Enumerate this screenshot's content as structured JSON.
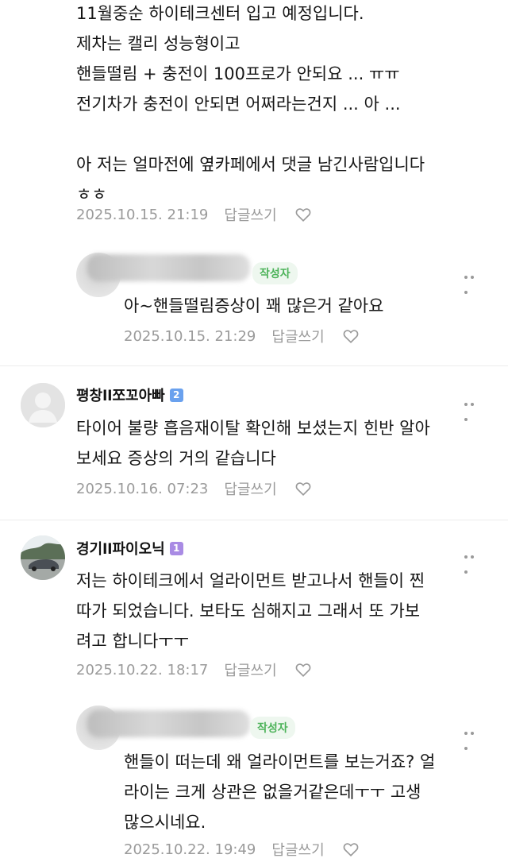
{
  "comments": [
    {
      "text": "11월중순 하이테크센터 입고 예정입니다.\n제차는 캘리 성능형이고\n핸들떨림 + 충전이 100프로가 안되요 ... ㅠㅠ\n전기차가 충전이 안되면 어쩌라는건지 ... 아 ...\n\n아 저는 얼마전에 옆카페에서 댓글 남긴사람입니다\nㅎㅎ",
      "date": "2025.10.15. 21:19",
      "reply_label": "답글쓰기"
    },
    {
      "author_tag": "작성자",
      "text": "아~핸들떨림증상이 꽤 많은거 같아요",
      "date": "2025.10.15. 21:29",
      "reply_label": "답글쓰기"
    },
    {
      "name": "평창ll쪼꼬아빠",
      "badge": "2",
      "text": "타이어 불량 흡음재이탈 확인해 보셨는지 힌반 알아\n보세요 증상의 거의 같습니다",
      "date": "2025.10.16. 07:23",
      "reply_label": "답글쓰기"
    },
    {
      "name": "경기ll파이오닉",
      "badge": "1",
      "text": "저는 하이테크에서 얼라이먼트 받고나서 핸들이 찐\n따가 되었습니다. 보타도 심해지고 그래서 또 가보\n려고 합니다ㅜㅜ",
      "date": "2025.10.22. 18:17",
      "reply_label": "답글쓰기"
    },
    {
      "author_tag": "작성자",
      "text": "핸들이 떠는데 왜 얼라이먼트를 보는거죠? 얼\n라이는 크게 상관은 없을거같은데ㅜㅜ 고생\n많으시네요.",
      "date": "2025.10.22. 19:49",
      "reply_label": "답글쓰기"
    }
  ],
  "colors": {
    "meta": "#9a9a9a",
    "author_tag_text": "#4db35a",
    "author_tag_bg": "#eef7ef",
    "badge_blue": "#6aa1ee",
    "badge_purple": "#a98be4"
  }
}
